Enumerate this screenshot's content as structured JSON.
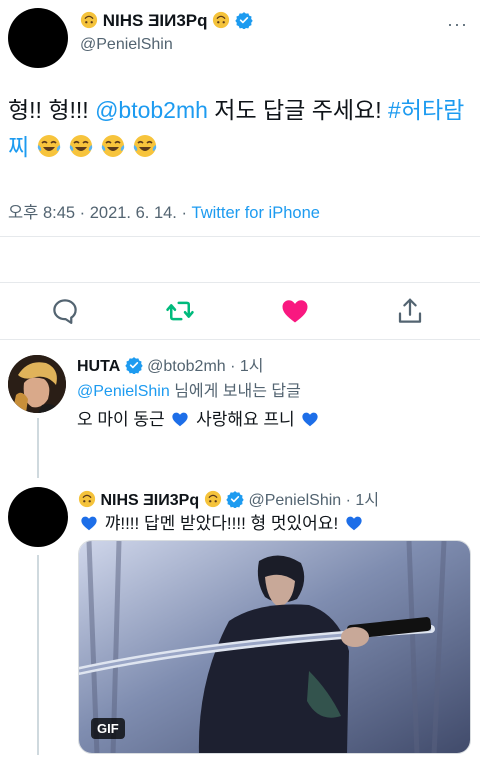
{
  "main_tweet": {
    "display_name": "NIHS ƎIИ3Pq",
    "handle": "@PenielShin",
    "more": "···",
    "text_part1": "형!! 형!!! ",
    "mention": "@btob2mh",
    "text_part2": " 저도 답글 주세요! ",
    "hashtag": "#허타람찌",
    "timestamp": "오후 8:45 · 2021. 6. 14. · ",
    "source": "Twitter for iPhone"
  },
  "actions": {
    "reply": "reply-icon",
    "retweet": "retweet-icon",
    "like": "heart-icon",
    "share": "share-icon"
  },
  "reply_huta": {
    "display_name": "HUTA",
    "handle_time": "@btob2mh · 1시",
    "replying_mention": "@PenielShin",
    "replying_suffix": " 님에게 보내는 답글",
    "text_part1": "오 마이 동근 ",
    "text_part2": " 사랑해요 프니 "
  },
  "reply_peniel": {
    "display_name": "NIHS ƎIИ3Pq",
    "handle_time": "@PenielShin · 1시",
    "text": " 꺄!!!! 답멘 받았다!!!! 형 멋있어요! ",
    "media_badge": "GIF"
  },
  "colors": {
    "link": "#1d9bf0",
    "retweet": "#00ba7c",
    "like": "#f91880",
    "blue_heart": "#1d6ee8"
  }
}
